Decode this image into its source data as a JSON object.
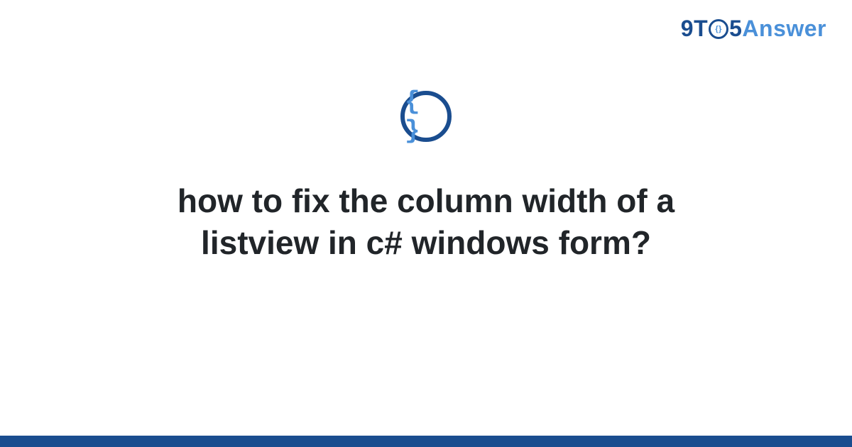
{
  "header": {
    "logo": {
      "prefix": "9T",
      "clock_inner": "{}",
      "mid": "5",
      "suffix": "Answer"
    }
  },
  "badge": {
    "glyph": "{ }"
  },
  "main": {
    "title": "how to fix the column width of a listview in c# windows form?"
  },
  "colors": {
    "brand_dark": "#1a4d8f",
    "brand_light": "#4a90d9"
  }
}
